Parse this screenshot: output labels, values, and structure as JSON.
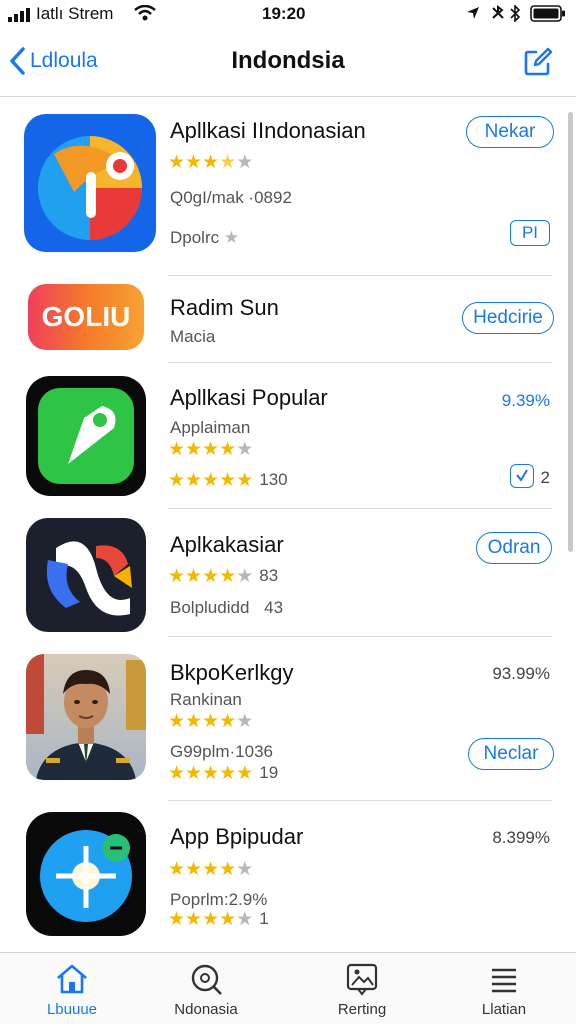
{
  "status_bar": {
    "carrier": "Iatlı Strem",
    "time": "19:20"
  },
  "nav": {
    "back_label": "Ldloula",
    "title": "Indondsia"
  },
  "apps": [
    {
      "name": "Apllkasi  IIndonasian",
      "rating": 3.5,
      "detail": "Q0gI/mak ·0892",
      "extra": "Dpolrc",
      "button": "Nekar",
      "small_button": "PI"
    },
    {
      "name": "Radim Sun",
      "logo_text": "GOLIU",
      "category": "Macia",
      "button": "Hedcirie"
    },
    {
      "name": "Apllkasi Popular",
      "category": "Applaiman",
      "rating_1": 4.5,
      "rating_2": 5,
      "rating_count": "130",
      "percent": "9.39%",
      "small_badge": "2"
    },
    {
      "name": "Aplkakasiar",
      "rating": 4.5,
      "rating_count": "83",
      "detail": "Bolpludidd",
      "detail_count": "43",
      "button": "Odran"
    },
    {
      "name": "BkpoKerlkgy",
      "category": "Rankinan",
      "rating_1": 4.5,
      "detail": "G99plm·1036",
      "rating_2": 5,
      "rating_count": "19",
      "percent": "93.99%",
      "button": "Neclar"
    },
    {
      "name": "App Bpipudar",
      "rating": 4.5,
      "detail": "Poprlm:2.9%",
      "rating_2": 4.5,
      "rating_count": "1",
      "percent": "8.399%"
    }
  ],
  "tabs": [
    {
      "label": "Lbuuue",
      "icon": "home-icon"
    },
    {
      "label": "Ndonasia",
      "icon": "search-icon"
    },
    {
      "label": "Rerting",
      "icon": "image-icon"
    },
    {
      "label": "Llatian",
      "icon": "list-icon"
    }
  ],
  "colors": {
    "accent": "#1878f0",
    "star": "#f5b800",
    "divider": "#dcdce0"
  }
}
